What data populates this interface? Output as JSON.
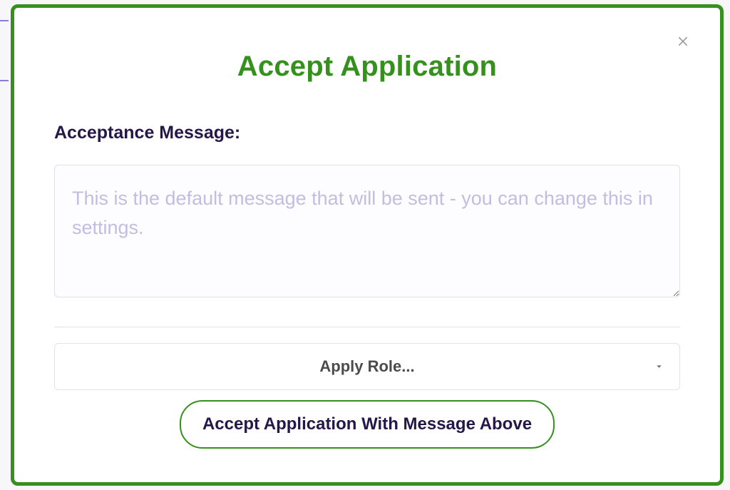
{
  "modal": {
    "title": "Accept Application",
    "close_label": "Close",
    "message_label": "Acceptance Message:",
    "message_placeholder": "This is the default message that will be sent - you can change this in settings.",
    "message_value": "",
    "role_dropdown": {
      "label": "Apply Role..."
    },
    "accept_button_label": "Accept Application With Message Above"
  },
  "colors": {
    "accent_green": "#36901e",
    "heading_dark": "#26174a",
    "placeholder": "#c3bde0"
  }
}
